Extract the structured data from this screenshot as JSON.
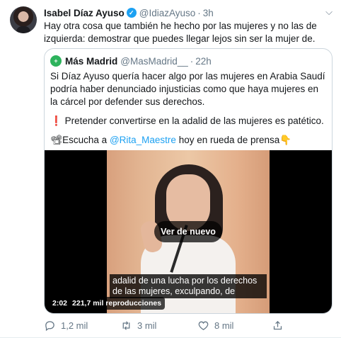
{
  "tweet": {
    "author_name": "Isabel Díaz Ayuso",
    "author_handle": "@IdiazAyuso",
    "separator": "·",
    "time": "3h",
    "text": "Hay otra cosa que también he hecho por las mujeres y no las de izquierda: demostrar que puedes llegar lejos sin ser la mujer de."
  },
  "quoted": {
    "author_name": "Más Madrid",
    "author_handle": "@MasMadrid__",
    "separator": "·",
    "time": "22h",
    "paragraph1": "Si Díaz Ayuso quería hacer algo por las mujeres en Arabia Saudí podría haber denunciado injusticias como que haya mujeres en la cárcel por defender sus derechos.",
    "paragraph2_emoji": "❗",
    "paragraph2": " Pretender convertirse en la adalid de las mujeres es patético.",
    "paragraph3_emoji": "📽",
    "paragraph3_pre": "Escucha a ",
    "paragraph3_mention": "@Rita_Maestre",
    "paragraph3_post": " hoy en rueda de prensa",
    "paragraph3_emoji_end": "👇",
    "video": {
      "replay_label": "Ver de nuevo",
      "subtitle_line1": "adalid de una lucha por los derechos",
      "subtitle_line2": "de las mujeres, exculpando, de",
      "duration": "2:02",
      "views": "221,7 mil reproducciones"
    }
  },
  "actions": {
    "reply_count": "1,2 mil",
    "retweet_count": "3 mil",
    "like_count": "8 mil"
  },
  "icons": {
    "verified": "verified-badge-icon",
    "caret": "chevron-down-icon",
    "reply": "reply-icon",
    "retweet": "retweet-icon",
    "like": "heart-icon",
    "share": "share-icon"
  },
  "colors": {
    "twitter_blue": "#1da1f2",
    "muted": "#657786",
    "mas_madrid_green": "#2db35c"
  }
}
